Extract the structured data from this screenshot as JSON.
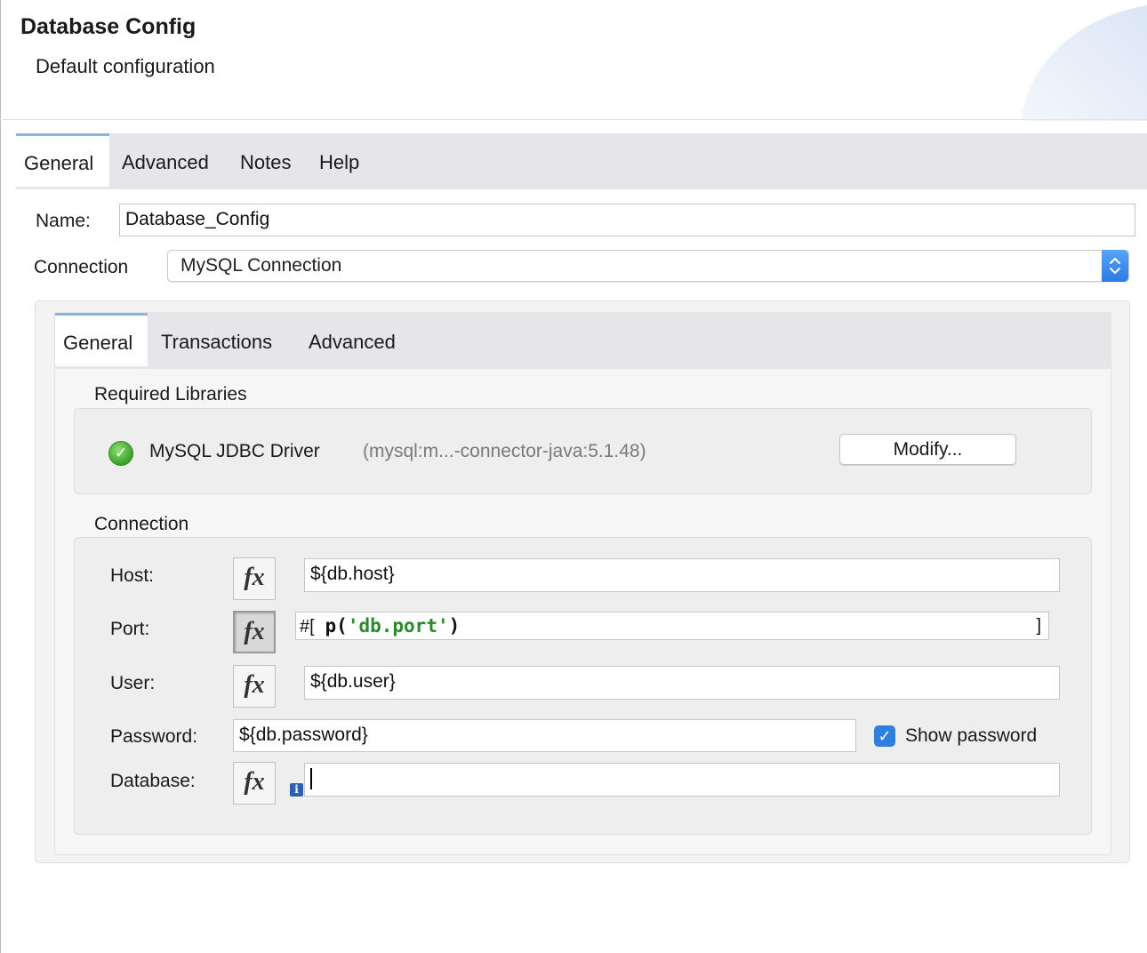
{
  "header": {
    "title": "Database Config",
    "subtitle": "Default configuration"
  },
  "tabs": [
    {
      "label": "General",
      "active": true
    },
    {
      "label": "Advanced",
      "active": false
    },
    {
      "label": "Notes",
      "active": false
    },
    {
      "label": "Help",
      "active": false
    }
  ],
  "form": {
    "name_label": "Name:",
    "name_value": "Database_Config",
    "connection_label": "Connection",
    "connection_value": "MySQL Connection"
  },
  "inner_tabs": [
    {
      "label": "General",
      "active": true
    },
    {
      "label": "Transactions",
      "active": false
    },
    {
      "label": "Advanced",
      "active": false
    }
  ],
  "required_libraries": {
    "title": "Required Libraries",
    "driver_name": "MySQL JDBC Driver",
    "driver_artifact": "(mysql:m...-connector-java:5.1.48)",
    "status": "ok",
    "modify_label": "Modify..."
  },
  "connection": {
    "title": "Connection",
    "fx_label": "fx",
    "host_label": "Host:",
    "host_value": "${db.host}",
    "port_label": "Port:",
    "port_prefix": "#[",
    "port_fn": "p(",
    "port_string": "'db.port'",
    "port_close": ")",
    "port_suffix": "]",
    "user_label": "User:",
    "user_value": "${db.user}",
    "password_label": "Password:",
    "password_value": "${db.password}",
    "show_password_label": "Show password",
    "show_password_checked": true,
    "database_label": "Database:",
    "database_value": ""
  },
  "colors": {
    "accent": "#2f7fe0",
    "tab_indicator": "#8fb4d8",
    "string_literal": "#2a8a2a"
  }
}
